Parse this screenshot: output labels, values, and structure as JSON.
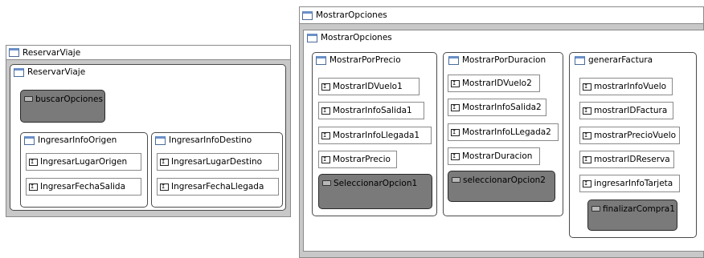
{
  "windows": {
    "reservar": {
      "title": "ReservarViaje",
      "panel_title": "ReservarViaje",
      "buscar_button": "buscarOpciones",
      "origen": {
        "title": "IngresarInfoOrigen",
        "fields": [
          "IngresarLugarOrigen",
          "IngresarFechaSalida"
        ]
      },
      "destino": {
        "title": "IngresarInfoDestino",
        "fields": [
          "IngresarLugarDestino",
          "IngresarFechaLlegada"
        ]
      }
    },
    "mostrar": {
      "title": "MostrarOpciones",
      "panel_title": "MostrarOpciones",
      "precio": {
        "title": "MostrarPorPrecio",
        "fields": [
          "MostrarIDVuelo1",
          "MostrarInfoSalida1",
          "MostrarInfoLlegada1",
          "MostrarPrecio"
        ],
        "button": "SeleccionarOpcion1"
      },
      "duracion": {
        "title": "MostrarPorDuracion",
        "fields": [
          "MostrarIDVuelo2",
          "MostrarInfoSalida2",
          "MostrarInfoLLegada2",
          "MostrarDuracion"
        ],
        "button": "seleccionarOpcion2"
      },
      "factura": {
        "title": "generarFactura",
        "fields": [
          "mostrarInfoVuelo",
          "mostrarIDFactura",
          "mostrarPrecioVuelo",
          "mostrarIDReserva",
          "ingresarInfoTarjeta"
        ],
        "button": "finalizarCompra1"
      }
    }
  },
  "icons": {
    "window": "window-icon",
    "text_field": "text-field-icon",
    "button": "button-icon"
  },
  "colors": {
    "window_bg": "#c8c8c8",
    "button_fill": "#7a7a7a",
    "panel_border": "#4a4a4a"
  }
}
